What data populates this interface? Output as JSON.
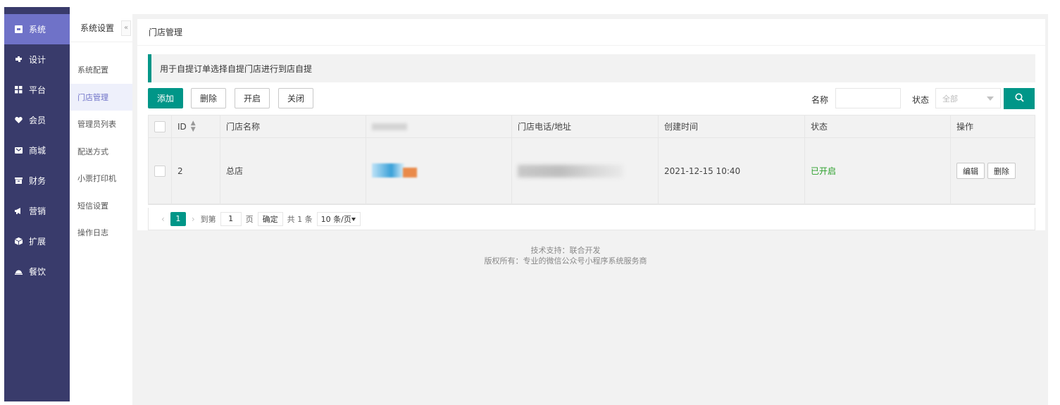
{
  "nav": {
    "items": [
      {
        "label": "系统",
        "icon": "monitor-icon",
        "active": true
      },
      {
        "label": "设计",
        "icon": "puzzle-icon"
      },
      {
        "label": "平台",
        "icon": "grid-icon"
      },
      {
        "label": "会员",
        "icon": "heart-icon"
      },
      {
        "label": "商城",
        "icon": "mail-icon"
      },
      {
        "label": "财务",
        "icon": "wallet-icon"
      },
      {
        "label": "营销",
        "icon": "megaphone-icon"
      },
      {
        "label": "扩展",
        "icon": "cube-icon"
      },
      {
        "label": "餐饮",
        "icon": "cloche-icon"
      }
    ]
  },
  "subnav": {
    "title": "系统设置",
    "collapse": "«",
    "items": [
      "系统配置",
      "门店管理",
      "管理员列表",
      "配送方式",
      "小票打印机",
      "短信设置",
      "操作日志"
    ],
    "active_index": 1
  },
  "card": {
    "title": "门店管理",
    "tip": "用于自提订单选择自提门店进行到店自提"
  },
  "toolbar": {
    "add": "添加",
    "delete": "删除",
    "open": "开启",
    "close": "关闭",
    "name_label": "名称",
    "name_value": "",
    "status_label": "状态",
    "status_placeholder": "全部"
  },
  "table": {
    "headers": [
      "ID",
      "门店名称",
      "门店图",
      "门店电话/地址",
      "创建时间",
      "状态",
      "操作"
    ],
    "rows": [
      {
        "id": "2",
        "name": "总店",
        "created": "2021-12-15 10:40",
        "status": "已开启",
        "edit": "编辑",
        "delete": "删除"
      }
    ]
  },
  "pager": {
    "prev": "‹",
    "current": "1",
    "next": "›",
    "goto_label": "到第",
    "goto_value": "1",
    "page_unit": "页",
    "confirm": "确定",
    "total": "共 1 条",
    "per_page": "10 条/页"
  },
  "footer": {
    "line1": "技术支持：联合开发",
    "line2": "版权所有：专业的微信公众号小程序系统服务商"
  },
  "colors": {
    "nav_bg": "#393b6b",
    "nav_active": "#6f72c8",
    "primary": "#009688",
    "status_on": "#2ca02c"
  }
}
